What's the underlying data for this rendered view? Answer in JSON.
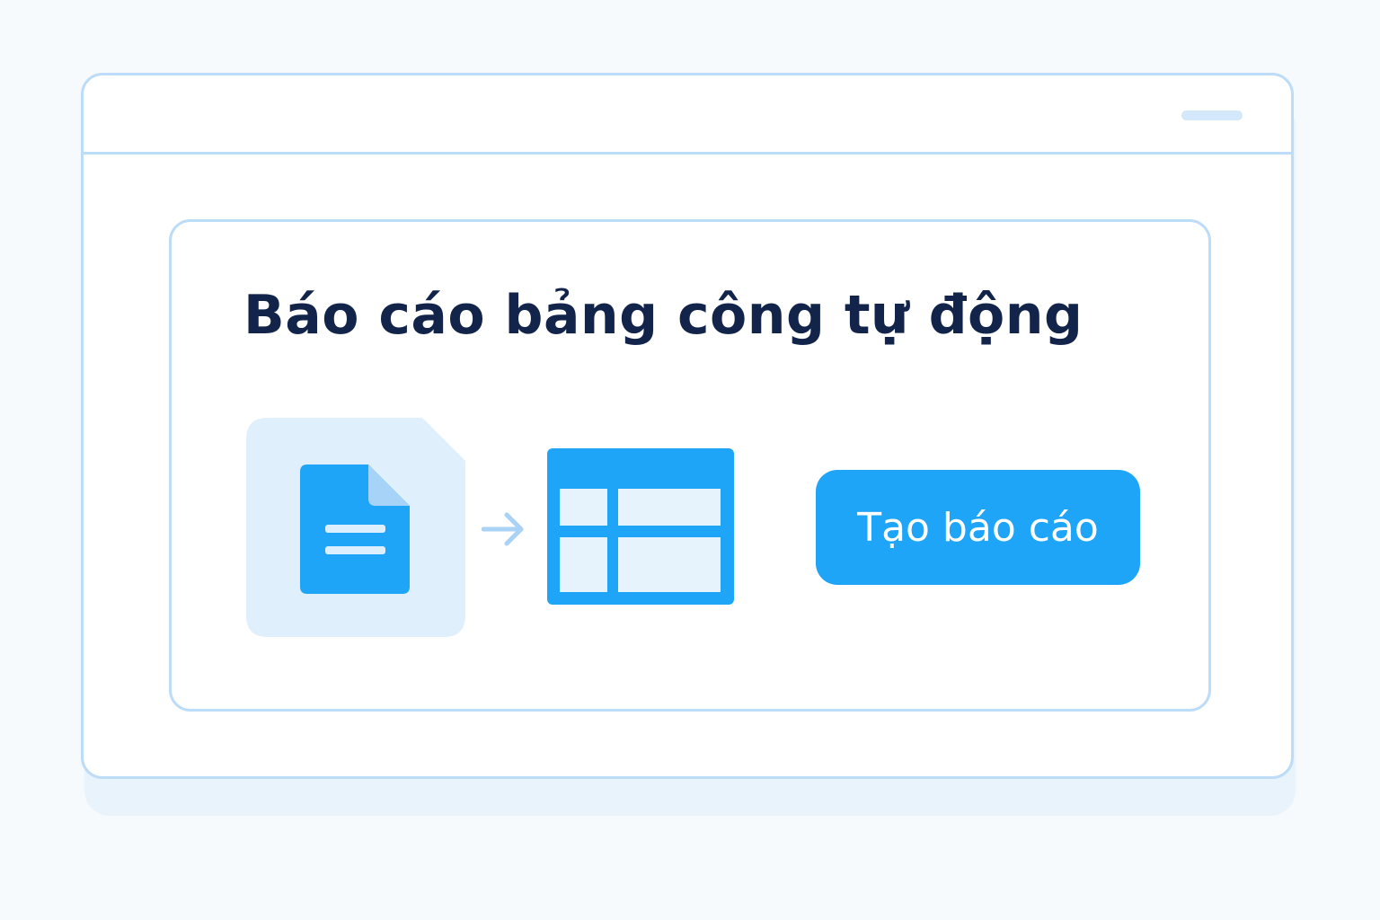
{
  "window": {
    "control": "window-control-bar"
  },
  "card": {
    "title": "Báo cáo bảng công tự động"
  },
  "illustration": {
    "source_icon": "document-icon",
    "arrow_icon": "arrow-right-icon",
    "target_icon": "table-icon"
  },
  "actions": {
    "create_report_label": "Tạo báo cáo"
  },
  "colors": {
    "accent": "#1fa5f7",
    "border": "#bcdcf7",
    "tile_background": "#e0effc",
    "title_text": "#12244a",
    "page_background": "#f6fafd"
  }
}
